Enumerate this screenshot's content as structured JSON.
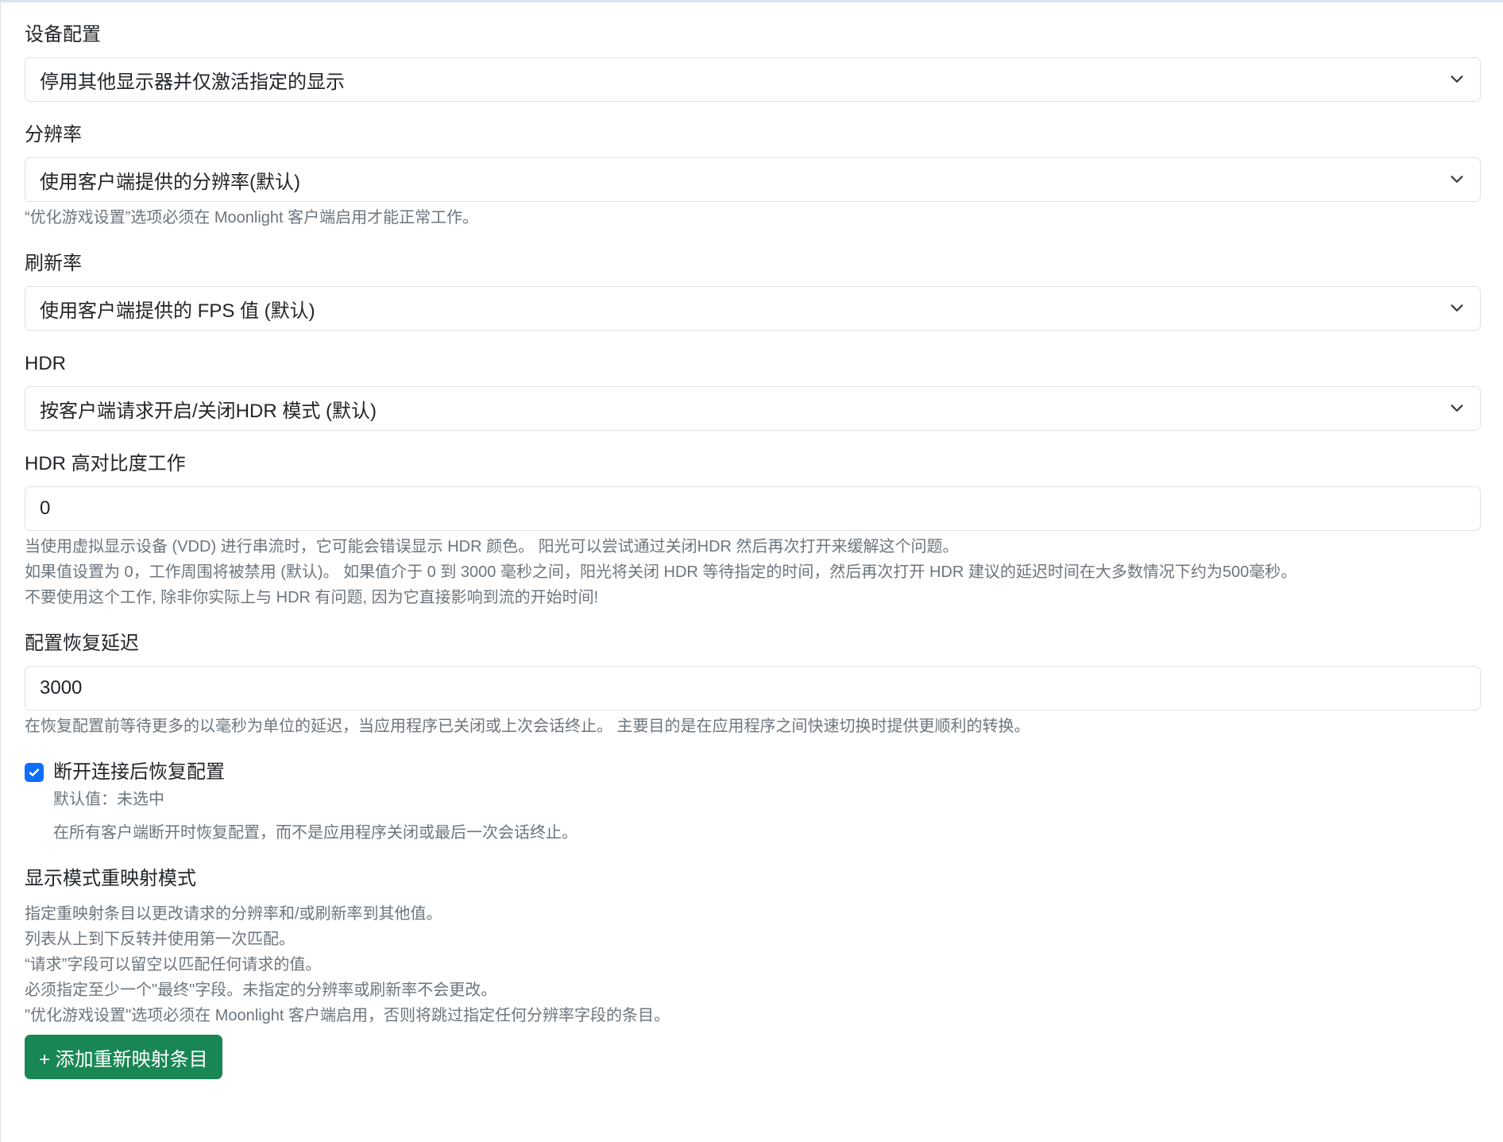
{
  "fields": {
    "device": {
      "label": "设备配置",
      "value": "停用其他显示器并仅激活指定的显示"
    },
    "resolution": {
      "label": "分辨率",
      "value": "使用客户端提供的分辨率(默认)",
      "help": "“优化游戏设置”选项必须在 Moonlight 客户端启用才能正常工作。"
    },
    "refresh": {
      "label": "刷新率",
      "value": "使用客户端提供的 FPS 值 (默认)"
    },
    "hdr": {
      "label": "HDR",
      "value": "按客户端请求开启/关闭HDR 模式 (默认)"
    },
    "hdr_work": {
      "label": "HDR 高对比度工作",
      "value": "0",
      "help": [
        "当使用虚拟显示设备 (VDD) 进行串流时，它可能会错误显示 HDR 颜色。 阳光可以尝试通过关闭HDR 然后再次打开来缓解这个问题。",
        "如果值设置为 0，工作周围将被禁用 (默认)。 如果值介于 0 到 3000 毫秒之间，阳光将关闭 HDR 等待指定的时间，然后再次打开 HDR 建议的延迟时间在大多数情况下约为500毫秒。",
        "不要使用这个工作, 除非你实际上与 HDR 有问题, 因为它直接影响到流的开始时间!"
      ]
    },
    "restore_delay": {
      "label": "配置恢复延迟",
      "value": "3000",
      "help": "在恢复配置前等待更多的以毫秒为单位的延迟，当应用程序已关闭或上次会话终止。 主要目的是在应用程序之间快速切换时提供更顺利的转换。"
    }
  },
  "checkbox": {
    "label": "断开连接后恢复配置",
    "default_text": "默认值：未选中",
    "description": "在所有客户端断开时恢复配置，而不是应用程序关闭或最后一次会话终止。"
  },
  "remap": {
    "title": "显示模式重映射模式",
    "help": [
      "指定重映射条目以更改请求的分辨率和/或刷新率到其他值。",
      "列表从上到下反转并使用第一次匹配。",
      "“请求”字段可以留空以匹配任何请求的值。",
      "必须指定至少一个\"最终\"字段。未指定的分辨率或刷新率不会更改。",
      "\"优化游戏设置\"选项必须在 Moonlight 客户端启用，否则将跳过指定任何分辨率字段的条目。"
    ],
    "button_label": "+ 添加重新映射条目"
  },
  "colors": {
    "primary": "#0d6efd",
    "success": "#198754"
  }
}
